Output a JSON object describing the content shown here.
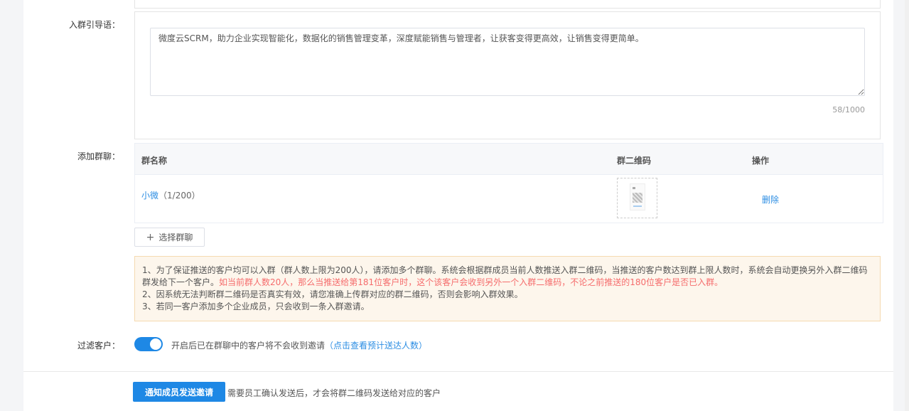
{
  "guide": {
    "label": "入群引导语：",
    "text": "微度云SCRM，助力企业实现智能化，数据化的销售管理变革，深度赋能销售与管理者，让获客变得更高效，让销售变得更简单。",
    "counter": "58/1000"
  },
  "groups": {
    "label": "添加群聊：",
    "columns": [
      "群名称",
      "群二维码",
      "操作"
    ],
    "rows": [
      {
        "name": "小微",
        "count": "（1/200）",
        "action": "删除"
      }
    ],
    "select_button": "选择群聊"
  },
  "notice": {
    "line1": "1、为了保证推送的客户均可以入群（群人数上限为200人），请添加多个群聊。系统会根据群成员当前人数推送入群二维码，当推送的客户数达到群上限人数时，系统会自动更换另外入群二维码群发给下一个客户。",
    "line1_red": "如当前群人数20人，那么当推送给第181位客户时，这个该客户会收到另外一个入群二维码，不论之前推送的180位客户是否已入群。",
    "line2": "2、因系统无法判断群二维码是否真实有效，请您准确上传群对应的群二维码，否则会影响入群效果。",
    "line3": "3、若同一客户添加多个企业成员，只会收到一条入群邀请。"
  },
  "filter": {
    "label": "过滤客户：",
    "enabled": true,
    "text": "开启后已在群聊中的客户将不会收到邀请",
    "link": "（点击查看预计送达人数）"
  },
  "submit": {
    "button": "通知成员发送邀请",
    "hint": "需要员工确认发送后，才会将群二维码发送给对应的客户"
  },
  "colors": {
    "primary": "#1e88e5",
    "link": "#2b8de3",
    "warning_bg": "#fdf6ec",
    "danger": "#f56c6c"
  }
}
